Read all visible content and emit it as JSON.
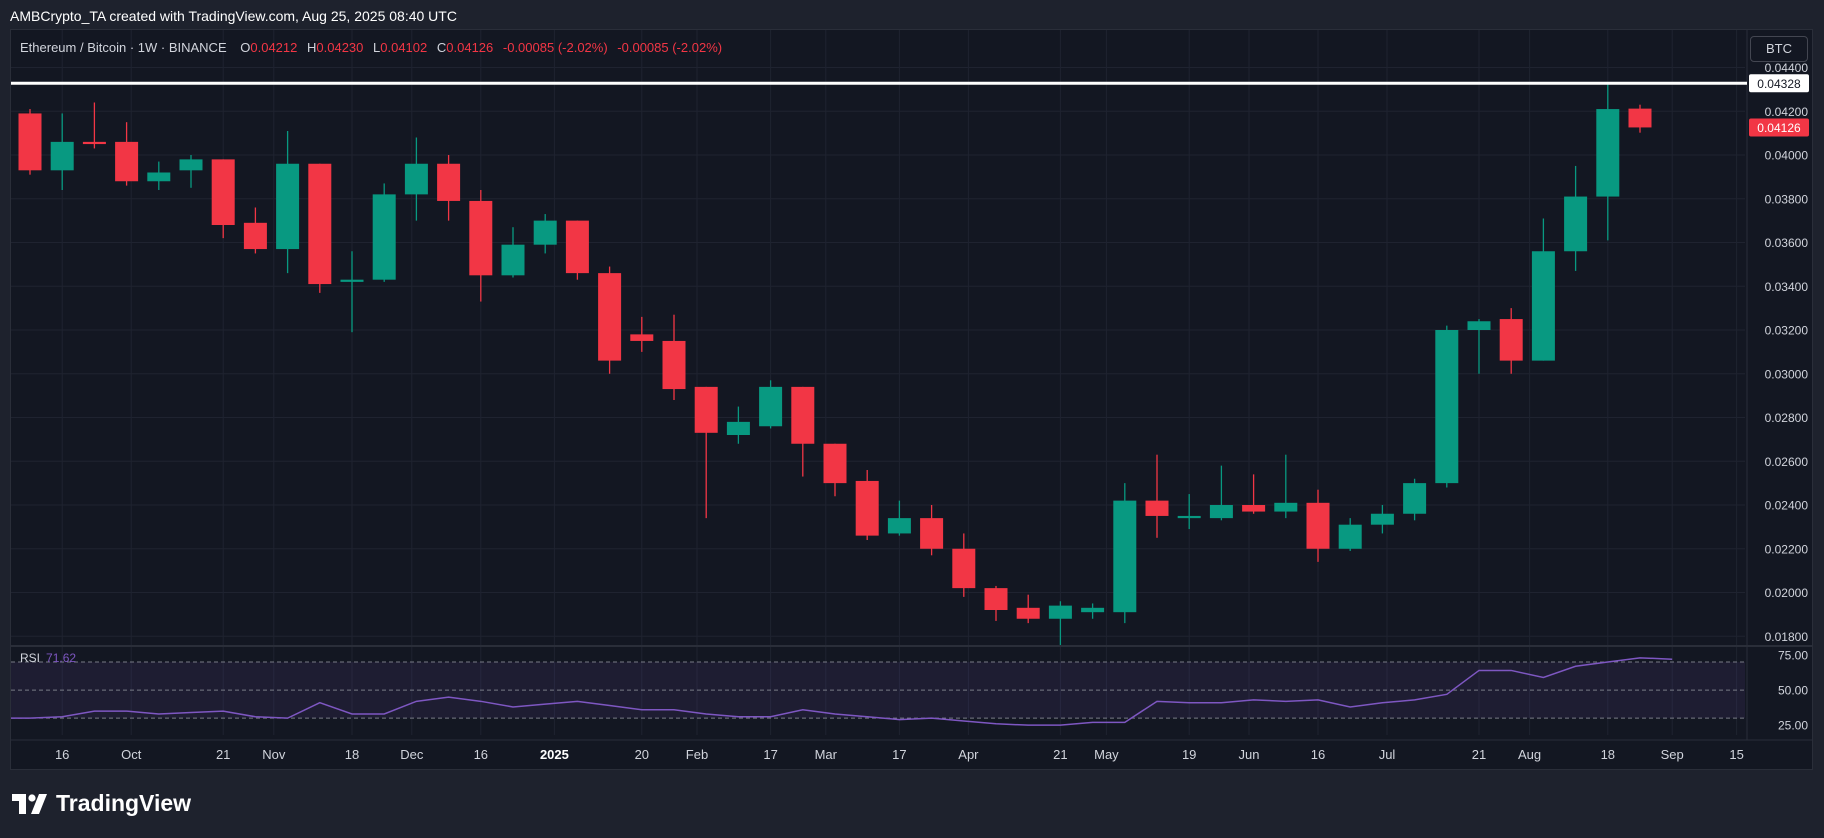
{
  "caption": "AMBCrypto_TA created with TradingView.com, Aug 25, 2025 08:40 UTC",
  "legend": {
    "symbol": "Ethereum / Bitcoin · 1W · BINANCE",
    "o_key": "O",
    "o_val": "0.04212",
    "h_key": "H",
    "h_val": "0.04230",
    "l_key": "L",
    "l_val": "0.04102",
    "c_key": "C",
    "c_val": "0.04126",
    "change": "-0.00085 (-2.02%)",
    "change2": "-0.00085 (-2.02%)"
  },
  "currency_button": "BTC",
  "rsi": {
    "name": "RSI",
    "value": "71.62"
  },
  "brand": "TradingView",
  "colors": {
    "up": "#089981",
    "down": "#f23645",
    "rsi": "#7e57c2",
    "background": "#131722",
    "grid": "#1f2330",
    "text": "#d1d4dc"
  },
  "chart_data": {
    "type": "candlestick",
    "title": "Ethereum / Bitcoin · 1W · BINANCE",
    "ylim": [
      0.0176,
      0.0448
    ],
    "y_ticks": [
      "0.04400",
      "0.04200",
      "0.04000",
      "0.03800",
      "0.03600",
      "0.03400",
      "0.03200",
      "0.03000",
      "0.02800",
      "0.02600",
      "0.02400",
      "0.02200",
      "0.02000",
      "0.01800"
    ],
    "x_ticks": [
      "16",
      "Oct",
      "21",
      "Nov",
      "18",
      "Dec",
      "16",
      "2025",
      "20",
      "Feb",
      "17",
      "Mar",
      "17",
      "Apr",
      "21",
      "May",
      "19",
      "Jun",
      "16",
      "Jul",
      "21",
      "Aug",
      "18",
      "Sep",
      "15"
    ],
    "x_ticks_bold": [
      "2025"
    ],
    "horizontal_line": {
      "value": 0.04328,
      "label": "0.04328",
      "color": "#ffffff"
    },
    "last_price": {
      "value": 0.04126,
      "label": "0.04126",
      "color": "#f23645"
    },
    "candles": [
      {
        "date": "2024-09-09",
        "o": 0.0419,
        "h": 0.0421,
        "l": 0.0391,
        "c": 0.0393
      },
      {
        "date": "2024-09-16",
        "o": 0.0393,
        "h": 0.0419,
        "l": 0.0384,
        "c": 0.0406
      },
      {
        "date": "2024-09-23",
        "o": 0.0406,
        "h": 0.0424,
        "l": 0.0403,
        "c": 0.0405
      },
      {
        "date": "2024-09-30",
        "o": 0.0406,
        "h": 0.0415,
        "l": 0.0386,
        "c": 0.0388
      },
      {
        "date": "2024-10-07",
        "o": 0.0388,
        "h": 0.0397,
        "l": 0.0384,
        "c": 0.0392
      },
      {
        "date": "2024-10-14",
        "o": 0.0393,
        "h": 0.04,
        "l": 0.0385,
        "c": 0.0398
      },
      {
        "date": "2024-10-21",
        "o": 0.0398,
        "h": 0.0398,
        "l": 0.0362,
        "c": 0.0368
      },
      {
        "date": "2024-10-28",
        "o": 0.0369,
        "h": 0.0376,
        "l": 0.0355,
        "c": 0.0357
      },
      {
        "date": "2024-11-04",
        "o": 0.0357,
        "h": 0.0411,
        "l": 0.0346,
        "c": 0.0396
      },
      {
        "date": "2024-11-11",
        "o": 0.0396,
        "h": 0.0396,
        "l": 0.0337,
        "c": 0.0341
      },
      {
        "date": "2024-11-18",
        "o": 0.0342,
        "h": 0.0356,
        "l": 0.0319,
        "c": 0.0343
      },
      {
        "date": "2024-11-25",
        "o": 0.0343,
        "h": 0.0387,
        "l": 0.0342,
        "c": 0.0382
      },
      {
        "date": "2024-12-02",
        "o": 0.0382,
        "h": 0.0408,
        "l": 0.037,
        "c": 0.0396
      },
      {
        "date": "2024-12-09",
        "o": 0.0396,
        "h": 0.04,
        "l": 0.037,
        "c": 0.0379
      },
      {
        "date": "2024-12-16",
        "o": 0.0379,
        "h": 0.0384,
        "l": 0.0333,
        "c": 0.0345
      },
      {
        "date": "2024-12-23",
        "o": 0.0345,
        "h": 0.0367,
        "l": 0.0344,
        "c": 0.0359
      },
      {
        "date": "2024-12-30",
        "o": 0.0359,
        "h": 0.0373,
        "l": 0.0355,
        "c": 0.037
      },
      {
        "date": "2025-01-06",
        "o": 0.037,
        "h": 0.037,
        "l": 0.0343,
        "c": 0.0346
      },
      {
        "date": "2025-01-13",
        "o": 0.0346,
        "h": 0.0349,
        "l": 0.03,
        "c": 0.0306
      },
      {
        "date": "2025-01-20",
        "o": 0.0318,
        "h": 0.0326,
        "l": 0.031,
        "c": 0.0315
      },
      {
        "date": "2025-01-27",
        "o": 0.0315,
        "h": 0.0327,
        "l": 0.0288,
        "c": 0.0293
      },
      {
        "date": "2025-02-03",
        "o": 0.0294,
        "h": 0.0294,
        "l": 0.0234,
        "c": 0.0273
      },
      {
        "date": "2025-02-10",
        "o": 0.0272,
        "h": 0.0285,
        "l": 0.0268,
        "c": 0.0278
      },
      {
        "date": "2025-02-17",
        "o": 0.0276,
        "h": 0.0297,
        "l": 0.0275,
        "c": 0.0294
      },
      {
        "date": "2025-02-24",
        "o": 0.0294,
        "h": 0.0294,
        "l": 0.0253,
        "c": 0.0268
      },
      {
        "date": "2025-03-03",
        "o": 0.0268,
        "h": 0.0268,
        "l": 0.0244,
        "c": 0.025
      },
      {
        "date": "2025-03-10",
        "o": 0.0251,
        "h": 0.0256,
        "l": 0.0224,
        "c": 0.0226
      },
      {
        "date": "2025-03-17",
        "o": 0.0227,
        "h": 0.0242,
        "l": 0.0226,
        "c": 0.0234
      },
      {
        "date": "2025-03-24",
        "o": 0.0234,
        "h": 0.024,
        "l": 0.0217,
        "c": 0.022
      },
      {
        "date": "2025-03-31",
        "o": 0.022,
        "h": 0.0227,
        "l": 0.0198,
        "c": 0.0202
      },
      {
        "date": "2025-04-07",
        "o": 0.0202,
        "h": 0.0203,
        "l": 0.0187,
        "c": 0.0192
      },
      {
        "date": "2025-04-14",
        "o": 0.0193,
        "h": 0.0199,
        "l": 0.0186,
        "c": 0.0188
      },
      {
        "date": "2025-04-21",
        "o": 0.0188,
        "h": 0.0196,
        "l": 0.0176,
        "c": 0.0194
      },
      {
        "date": "2025-04-28",
        "o": 0.0191,
        "h": 0.0195,
        "l": 0.0188,
        "c": 0.0193
      },
      {
        "date": "2025-05-05",
        "o": 0.0191,
        "h": 0.025,
        "l": 0.0186,
        "c": 0.0242
      },
      {
        "date": "2025-05-12",
        "o": 0.0242,
        "h": 0.0263,
        "l": 0.0225,
        "c": 0.0235
      },
      {
        "date": "2025-05-19",
        "o": 0.0234,
        "h": 0.0245,
        "l": 0.0229,
        "c": 0.0235
      },
      {
        "date": "2025-05-26",
        "o": 0.0234,
        "h": 0.0258,
        "l": 0.0233,
        "c": 0.024
      },
      {
        "date": "2025-06-02",
        "o": 0.024,
        "h": 0.0254,
        "l": 0.0236,
        "c": 0.0237
      },
      {
        "date": "2025-06-09",
        "o": 0.0237,
        "h": 0.0263,
        "l": 0.0234,
        "c": 0.0241
      },
      {
        "date": "2025-06-16",
        "o": 0.0241,
        "h": 0.0247,
        "l": 0.0214,
        "c": 0.022
      },
      {
        "date": "2025-06-23",
        "o": 0.022,
        "h": 0.0234,
        "l": 0.0219,
        "c": 0.0231
      },
      {
        "date": "2025-06-30",
        "o": 0.0231,
        "h": 0.024,
        "l": 0.0227,
        "c": 0.0236
      },
      {
        "date": "2025-07-07",
        "o": 0.0236,
        "h": 0.0252,
        "l": 0.0233,
        "c": 0.025
      },
      {
        "date": "2025-07-14",
        "o": 0.025,
        "h": 0.0322,
        "l": 0.0248,
        "c": 0.032
      },
      {
        "date": "2025-07-21",
        "o": 0.032,
        "h": 0.0325,
        "l": 0.03,
        "c": 0.0324
      },
      {
        "date": "2025-07-28",
        "o": 0.0325,
        "h": 0.033,
        "l": 0.03,
        "c": 0.0306
      },
      {
        "date": "2025-08-04",
        "o": 0.0306,
        "h": 0.0371,
        "l": 0.0306,
        "c": 0.0356
      },
      {
        "date": "2025-08-11",
        "o": 0.0356,
        "h": 0.0395,
        "l": 0.0347,
        "c": 0.0381
      },
      {
        "date": "2025-08-18",
        "o": 0.0381,
        "h": 0.04328,
        "l": 0.0361,
        "c": 0.0421
      },
      {
        "date": "2025-08-25",
        "o": 0.04212,
        "h": 0.0423,
        "l": 0.04102,
        "c": 0.04126
      }
    ],
    "rsi": {
      "ylim": [
        18,
        80
      ],
      "levels": [
        70,
        50,
        30
      ],
      "y_ticks": [
        "75.00",
        "50.00",
        "25.00"
      ],
      "values": [
        30,
        31,
        35,
        35,
        33,
        34,
        35,
        31,
        30,
        41,
        33,
        33,
        42,
        45,
        42,
        38,
        40,
        42,
        39,
        36,
        36,
        33,
        31,
        31,
        36,
        33,
        31,
        29,
        30,
        28,
        26,
        25,
        25,
        27,
        27,
        42,
        41,
        41,
        43,
        42,
        43,
        38,
        41,
        43,
        47,
        64,
        64,
        59,
        67,
        70,
        73,
        72
      ]
    }
  }
}
